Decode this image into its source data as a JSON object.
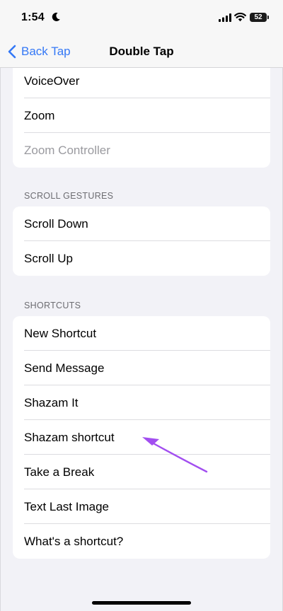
{
  "status_bar": {
    "time": "1:54",
    "battery": "52"
  },
  "nav": {
    "back_label": "Back Tap",
    "title": "Double Tap"
  },
  "groups": [
    {
      "items": [
        {
          "label": "VoiceOver"
        },
        {
          "label": "Zoom"
        },
        {
          "label": "Zoom Controller",
          "disabled": true
        }
      ]
    },
    {
      "header": "SCROLL GESTURES",
      "items": [
        {
          "label": "Scroll Down"
        },
        {
          "label": "Scroll Up"
        }
      ]
    },
    {
      "header": "SHORTCUTS",
      "items": [
        {
          "label": "New Shortcut"
        },
        {
          "label": "Send Message"
        },
        {
          "label": "Shazam It"
        },
        {
          "label": "Shazam shortcut"
        },
        {
          "label": "Take a Break"
        },
        {
          "label": "Text Last Image"
        },
        {
          "label": "What's a shortcut?"
        }
      ]
    }
  ],
  "colors": {
    "accent": "#3478f6",
    "annotation_arrow": "#a24ef0"
  },
  "icons": [
    "moon-icon",
    "signal-icon",
    "wifi-icon",
    "battery-icon",
    "chevron-left-icon",
    "annotation-arrow-icon"
  ]
}
